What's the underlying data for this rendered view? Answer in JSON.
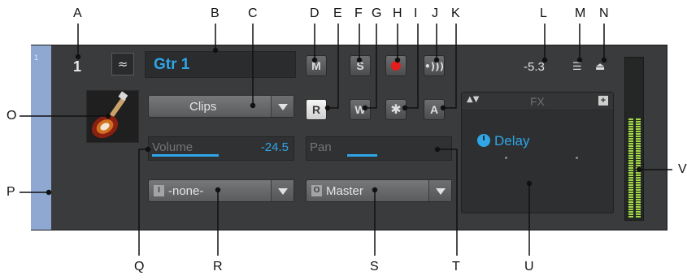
{
  "callouts": [
    "A",
    "B",
    "C",
    "D",
    "E",
    "F",
    "G",
    "H",
    "I",
    "J",
    "K",
    "L",
    "M",
    "N",
    "O",
    "P",
    "Q",
    "R",
    "S",
    "T",
    "U",
    "V"
  ],
  "track": {
    "strip_number": "1",
    "number": "1",
    "name": "Gtr 1",
    "volume_readout": "-5.3",
    "clips_label": "Clips",
    "buttons": {
      "mute": "M",
      "solo": "S",
      "read": "R",
      "write": "W",
      "automation": "A"
    },
    "volume": {
      "label": "Volume",
      "value": "-24.5",
      "level": 0.48
    },
    "pan": {
      "label": "Pan",
      "level": 0.5
    },
    "input": {
      "icon": "I",
      "label": "-none-"
    },
    "output": {
      "icon": "O",
      "label": "Master"
    },
    "fx": {
      "title": "FX",
      "plus": "+",
      "item": "Delay"
    },
    "meter": {
      "level": 0.63
    }
  },
  "icons": {
    "track_type": "waveform-icon",
    "record": "record-icon",
    "input_monitor": "input-monitor-icon",
    "freeze": "freeze-icon",
    "menu": "menu-icon",
    "collapse": "collapse-arrow-icon",
    "instrument": "guitar-image-icon",
    "fx_power": "power-icon"
  },
  "colors": {
    "accent": "#2ea6e8",
    "record": "#e41d1d",
    "strip": "#8ea8d2",
    "meter": "#a2d84a"
  }
}
